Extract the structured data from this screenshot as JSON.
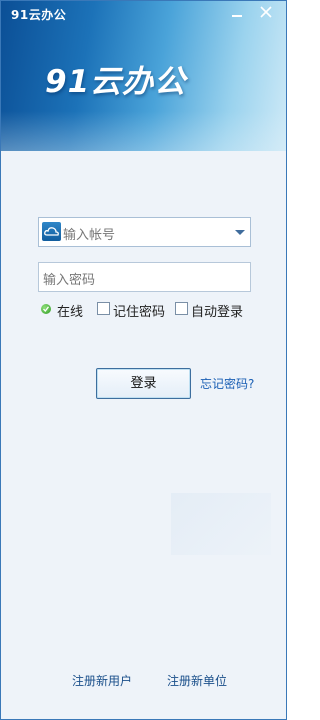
{
  "window": {
    "title": "91云办公",
    "logo_text": "91云办公"
  },
  "login": {
    "account_placeholder": "输入帐号",
    "password_placeholder": "输入密码",
    "status_label": "在线",
    "remember_label": "记住密码",
    "auto_login_label": "自动登录",
    "login_button": "登录",
    "forgot_password": "忘记密码?"
  },
  "footer": {
    "register_user": "注册新用户",
    "register_unit": "注册新单位"
  },
  "colors": {
    "header_dark": "#0b4f96",
    "header_light": "#cfeaf7",
    "link": "#1a5fb4",
    "background": "#eef3f9"
  },
  "icons": [
    "cloud-icon",
    "dropdown-arrow-icon",
    "online-status-icon",
    "minimize-icon",
    "close-icon"
  ]
}
